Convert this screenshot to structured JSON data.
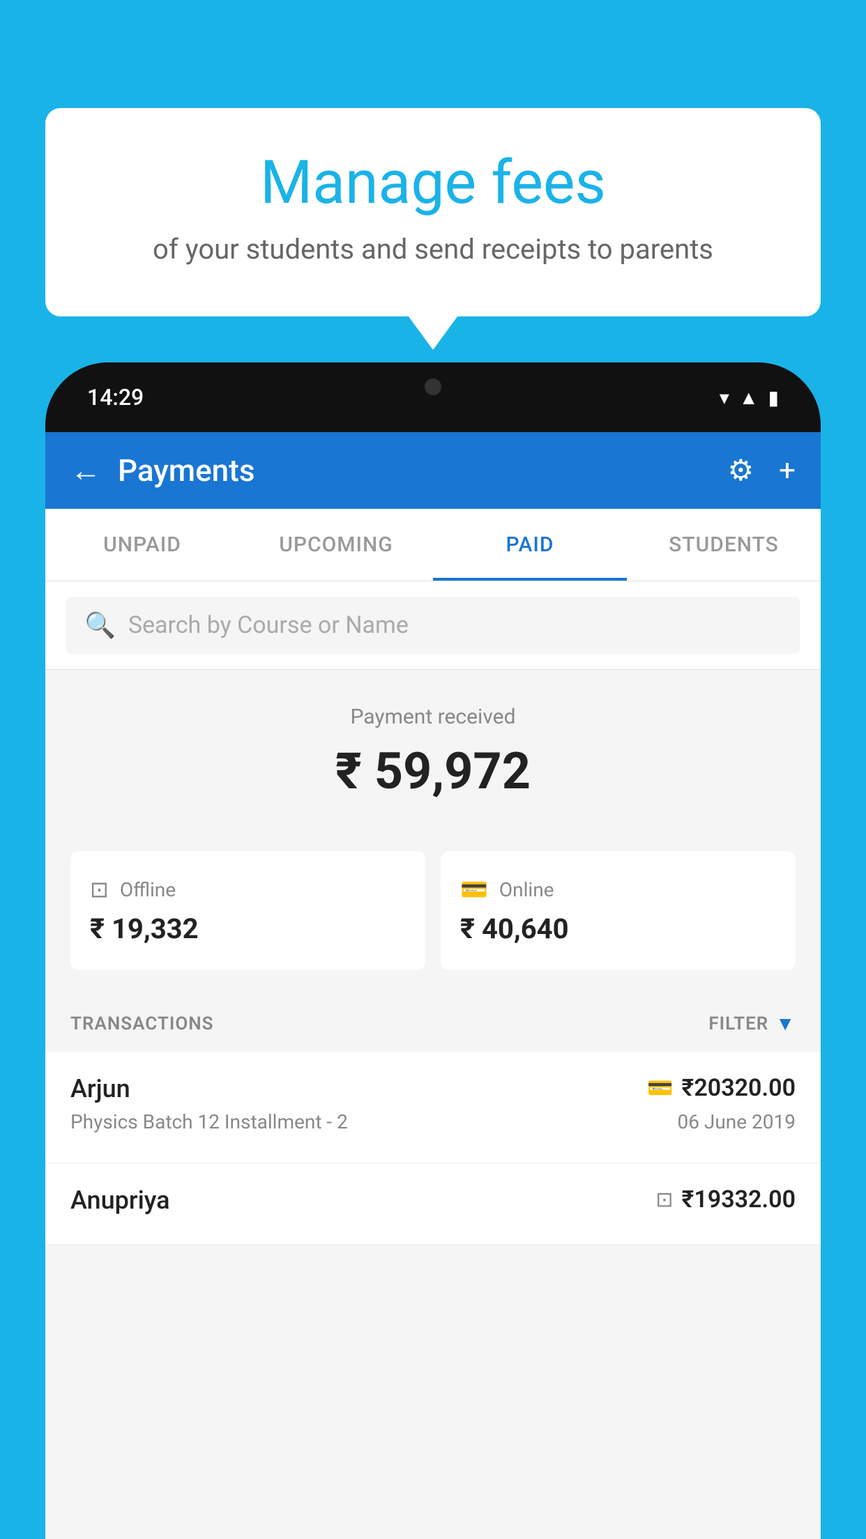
{
  "background_color": "#1ab3e8",
  "speech_bubble": {
    "title": "Manage fees",
    "subtitle": "of your students and send receipts to parents"
  },
  "phone": {
    "status_bar": {
      "time": "14:29"
    },
    "header": {
      "title": "Payments",
      "back_label": "←",
      "settings_label": "⚙",
      "add_label": "+"
    },
    "tabs": [
      {
        "label": "UNPAID",
        "active": false
      },
      {
        "label": "UPCOMING",
        "active": false
      },
      {
        "label": "PAID",
        "active": true
      },
      {
        "label": "STUDENTS",
        "active": false
      }
    ],
    "search": {
      "placeholder": "Search by Course or Name"
    },
    "payment_summary": {
      "label": "Payment received",
      "amount": "₹ 59,972",
      "offline_label": "Offline",
      "offline_amount": "₹ 19,332",
      "online_label": "Online",
      "online_amount": "₹ 40,640"
    },
    "transactions": {
      "header_label": "TRANSACTIONS",
      "filter_label": "FILTER",
      "items": [
        {
          "name": "Arjun",
          "course": "Physics Batch 12 Installment - 2",
          "amount": "₹20320.00",
          "date": "06 June 2019",
          "payment_type": "online"
        },
        {
          "name": "Anupriya",
          "course": "",
          "amount": "₹19332.00",
          "date": "",
          "payment_type": "offline"
        }
      ]
    }
  }
}
